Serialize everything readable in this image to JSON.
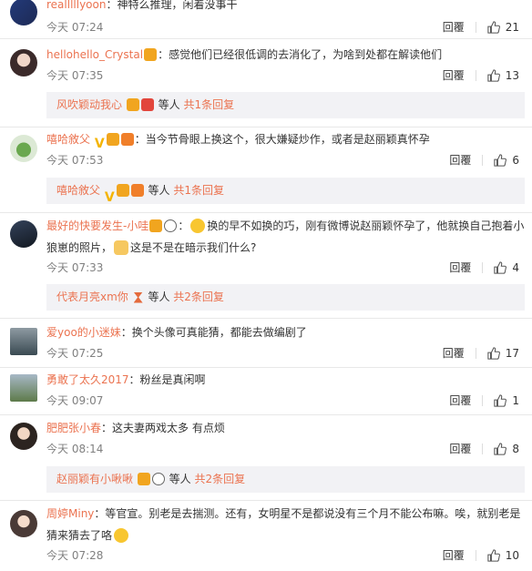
{
  "comments": [
    {
      "username": "realllllyoon",
      "text": "：神特么推理，闲着没事干",
      "time": "今天 07:24",
      "reply_label": "回覆",
      "likes": "21"
    },
    {
      "username": "hellohello_Crystal",
      "text": "：感觉他们已经很低调的去消化了，为啥到处都在解读他们",
      "time": "今天 07:35",
      "reply_label": "回覆",
      "likes": "13",
      "reply_preview": {
        "user": "风吹颖动我心",
        "mid": "等人",
        "more": "共1条回复"
      }
    },
    {
      "username": "嘻哈敘父",
      "text": "：当今节骨眼上换这个，很大嫌疑炒作，或者是赵丽颖真怀孕",
      "time": "今天 07:53",
      "reply_label": "回覆",
      "likes": "6",
      "reply_preview": {
        "user": "嘻哈敘父",
        "mid": "等人",
        "more": "共1条回复"
      }
    },
    {
      "username": "最好的快要发生-小哇",
      "text_a": "换的早不如换的巧，刚有微博说赵丽颖怀孕了，他就换自己抱着小狼崽的照片，",
      "text_b": "这是不是在暗示我们什么?",
      "time": "今天 07:33",
      "reply_label": "回覆",
      "likes": "4",
      "reply_preview": {
        "user": "代表月亮xm你",
        "mid": "等人",
        "more": "共2条回复"
      }
    },
    {
      "username": "爱yoo的小迷妹",
      "text": "：换个头像可真能猜，都能去做编剧了",
      "time": "今天 07:25",
      "reply_label": "回覆",
      "likes": "17"
    },
    {
      "username": "勇敢了太久2017",
      "text": "：粉丝是真闲啊",
      "time": "今天 09:07",
      "reply_label": "回覆",
      "likes": "1"
    },
    {
      "username": "肥肥张小春",
      "text": "：这夫妻两戏太多 有点烦",
      "time": "今天 08:14",
      "reply_label": "回覆",
      "likes": "8",
      "reply_preview": {
        "user": "赵丽颖有小啾啾",
        "mid": "等人",
        "more": "共2条回复"
      }
    },
    {
      "username": "周婷Miny",
      "text": "：等官宣。别老是去揣测。还有，女明星不是都说没有三个月不能公布嘛。唉，就别老是猜来猜去了咯",
      "time": "今天 07:28",
      "reply_label": "回覆",
      "likes": "10"
    }
  ],
  "icons": {
    "like": "thumbs-up-icon"
  },
  "colors": {
    "username": "#eb7350",
    "reply_bg": "#f2f2f5"
  }
}
